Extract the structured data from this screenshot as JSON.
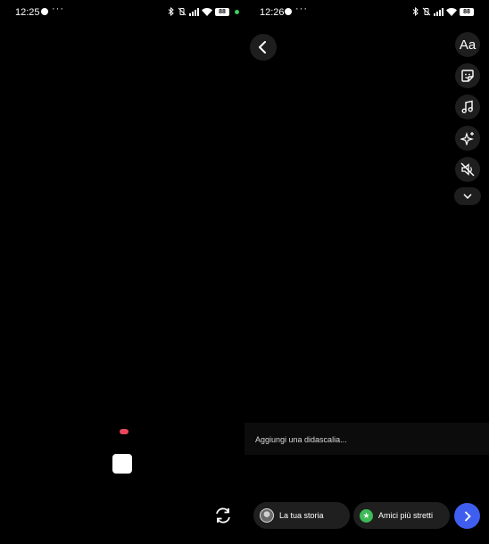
{
  "left": {
    "status": {
      "time": "12:25",
      "more": "···",
      "battery": "88"
    },
    "icons": {
      "flip": "camera-flip-icon"
    }
  },
  "right": {
    "status": {
      "time": "12:26",
      "more": "···",
      "battery": "88"
    },
    "tools": {
      "text_label": "Aa",
      "icons": [
        "back-icon",
        "text-icon",
        "sticker-icon",
        "music-icon",
        "effects-sparkle-icon",
        "mute-icon",
        "chevron-down-icon"
      ]
    },
    "caption": {
      "placeholder": "Aggiungi una didascalia..."
    },
    "share": {
      "story_label": "La tua storia",
      "close_friends_label": "Amici più stretti"
    }
  },
  "colors": {
    "accent": "#3f5ef0",
    "record_dot": "#e8475a",
    "close_friends": "#3dbb56"
  }
}
